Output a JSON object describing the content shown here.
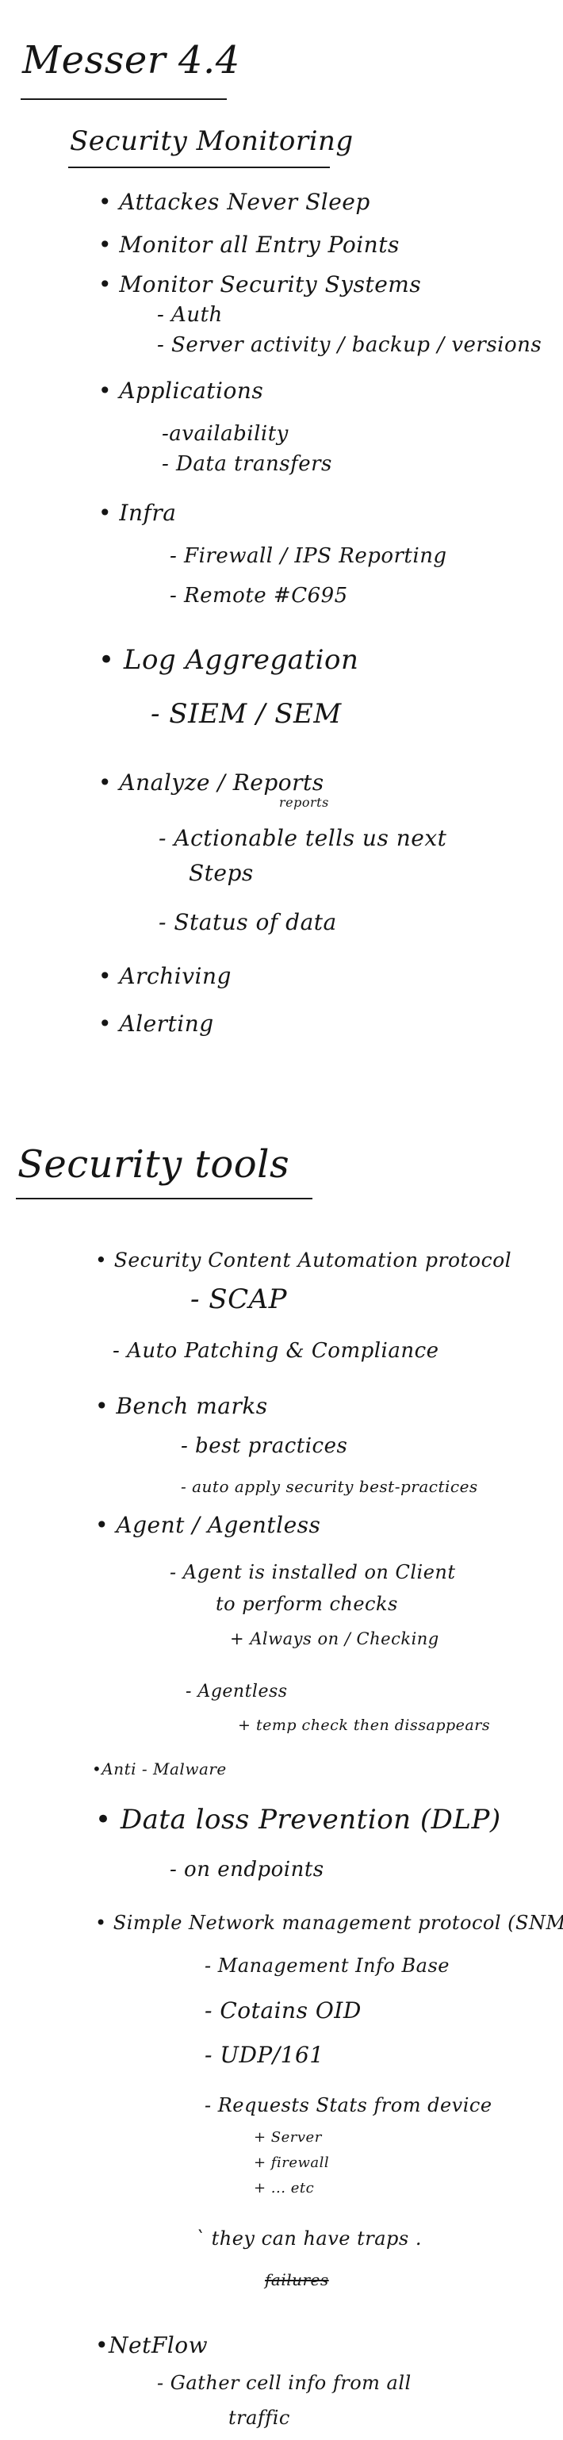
{
  "title": "Messer 4.4",
  "section1": {
    "heading": "Security Monitoring",
    "items": {
      "attacks": "• Attackes Never Sleep",
      "entry": "• Monitor all Entry Points",
      "systems": "• Monitor Security Systems",
      "auth": "- Auth",
      "server": "- Server activity / backup / versions",
      "applications": "• Applications",
      "availability": "-availability",
      "transfers": "- Data transfers",
      "infra": "• Infra",
      "firewall": "- Firewall / IPS Reporting",
      "remote": "- Remote #C695",
      "log": "• Log Aggregation",
      "siem": "- SIEM / SEM",
      "analyze": "• Analyze / Reports",
      "reports_note": "reports",
      "actionable": "- Actionable tells us next",
      "steps": "Steps",
      "status": "- Status of data",
      "archiving": "• Archiving",
      "alerting": "• Alerting"
    }
  },
  "section2": {
    "heading": "Security tools",
    "items": {
      "scap_full": "• Security Content Automation protocol",
      "scap": "- SCAP",
      "auto_patch": "- Auto Patching & Compliance",
      "benchmarks": "• Bench marks",
      "best": "- best practices",
      "auto_apply": "- auto apply security best-practices",
      "agent": "• Agent / Agentless",
      "agent_installed": "- Agent is installed on Client",
      "perform": "to perform checks",
      "always": "+ Always on / Checking",
      "agentless": "- Agentless",
      "temp": "+ temp check then dissappears",
      "antimalware": "•Anti - Malware",
      "dlp": "• Data loss Prevention (DLP)",
      "endpoints": "- on endpoints",
      "snmp": "• Simple Network management protocol (SNMP)",
      "mib": "- Management Info Base",
      "oid": "- Cotains OID",
      "udp": "- UDP/161",
      "requests": "- Requests Stats from device",
      "srv": "+ Server",
      "fw": "+ firewall",
      "etc": "+ ... etc",
      "traps": "` they can have traps .",
      "failures": "failures",
      "netflow": "•NetFlow",
      "gather": "- Gather cell info from all",
      "traffic": "traffic"
    }
  }
}
